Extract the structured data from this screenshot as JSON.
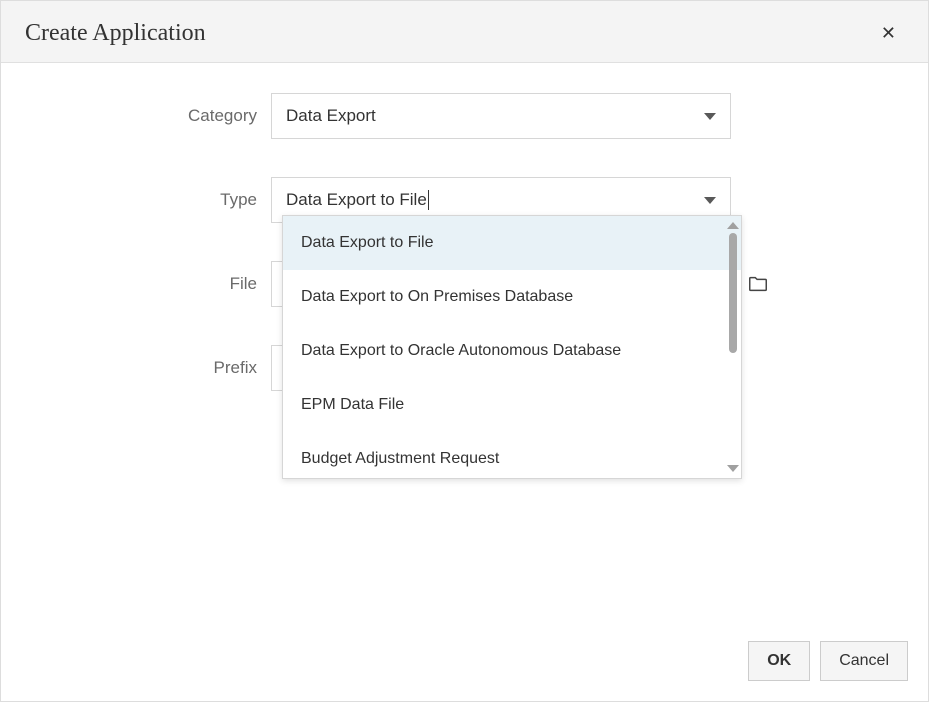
{
  "dialog": {
    "title": "Create Application"
  },
  "form": {
    "category": {
      "label": "Category",
      "value": "Data Export"
    },
    "type": {
      "label": "Type",
      "value": "Data Export to File",
      "options": [
        "Data Export to File",
        "Data Export to On Premises Database",
        "Data Export to Oracle Autonomous Database",
        "EPM Data File",
        "Budget Adjustment Request"
      ]
    },
    "file": {
      "label": "File"
    },
    "prefix": {
      "label": "Prefix"
    }
  },
  "buttons": {
    "ok": "OK",
    "cancel": "Cancel"
  }
}
